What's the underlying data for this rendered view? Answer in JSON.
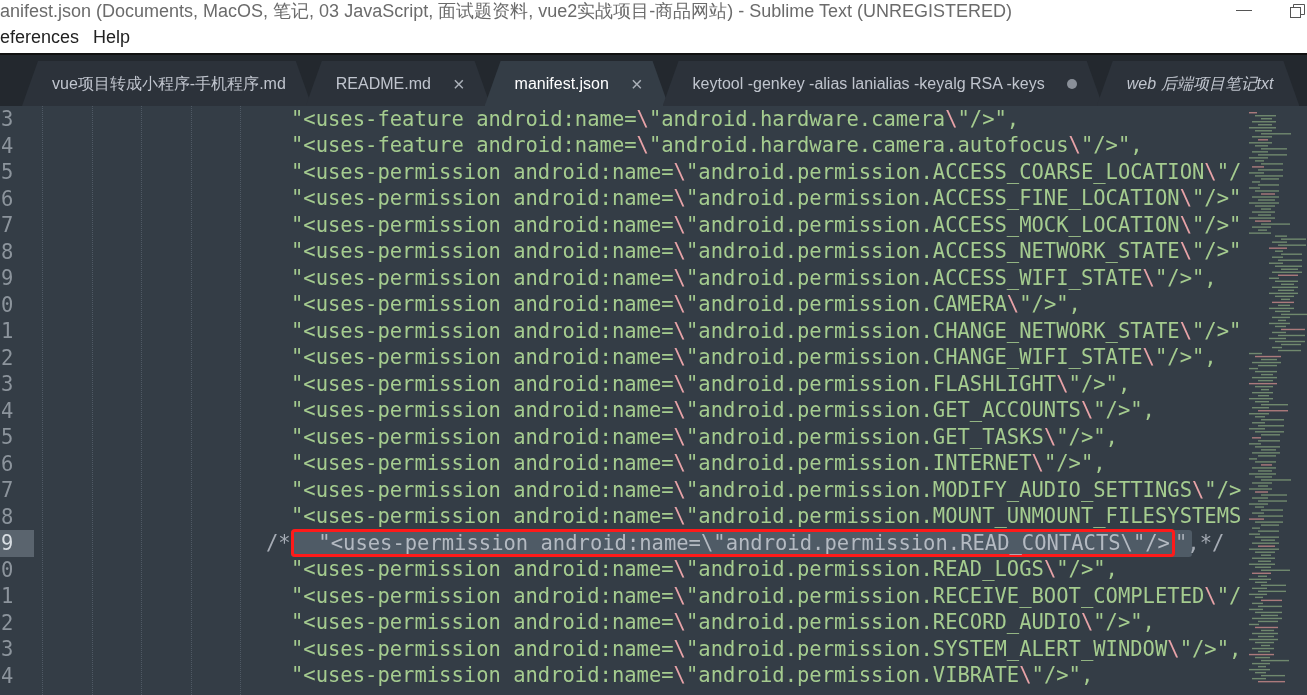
{
  "window": {
    "title": "anifest.json (Documents, MacOS, 笔记, 03 JavaScript, 面试题资料, vue2实战项目-商品网站) - Sublime Text (UNREGISTERED)"
  },
  "menu": [
    "eferences",
    "Help"
  ],
  "tabs": [
    {
      "label": "vue项目转成小程序-手机程序.md",
      "selected": false,
      "modified": false,
      "transient": false
    },
    {
      "label": "README.md",
      "selected": false,
      "modified": false,
      "transient": false,
      "close": "×"
    },
    {
      "label": "manifest.json",
      "selected": true,
      "modified": false,
      "transient": false,
      "close": "×"
    },
    {
      "label": "keytool -genkey -alias lanialias -keyalg RSA -keys",
      "selected": false,
      "modified": true,
      "transient": false
    },
    {
      "label": "web 后端项目笔记txt",
      "selected": false,
      "modified": false,
      "transient": true
    }
  ],
  "lines": [
    {
      "number": "3",
      "kind": "string",
      "selected": false,
      "text": "\"<uses-feature android:name=\\\"android.hardware.camera\\\"/>\","
    },
    {
      "number": "4",
      "kind": "string",
      "selected": false,
      "text": "\"<uses-feature android:name=\\\"android.hardware.camera.autofocus\\\"/>\","
    },
    {
      "number": "5",
      "kind": "string",
      "selected": false,
      "text": "\"<uses-permission android:name=\\\"android.permission.ACCESS_COARSE_LOCATION\\\"/"
    },
    {
      "number": "6",
      "kind": "string",
      "selected": false,
      "text": "\"<uses-permission android:name=\\\"android.permission.ACCESS_FINE_LOCATION\\\"/>\""
    },
    {
      "number": "7",
      "kind": "string",
      "selected": false,
      "text": "\"<uses-permission android:name=\\\"android.permission.ACCESS_MOCK_LOCATION\\\"/>\""
    },
    {
      "number": "8",
      "kind": "string",
      "selected": false,
      "text": "\"<uses-permission android:name=\\\"android.permission.ACCESS_NETWORK_STATE\\\"/>\""
    },
    {
      "number": "9",
      "kind": "string",
      "selected": false,
      "text": "\"<uses-permission android:name=\\\"android.permission.ACCESS_WIFI_STATE\\\"/>\","
    },
    {
      "number": "0",
      "kind": "string",
      "selected": false,
      "text": "\"<uses-permission android:name=\\\"android.permission.CAMERA\\\"/>\","
    },
    {
      "number": "1",
      "kind": "string",
      "selected": false,
      "text": "\"<uses-permission android:name=\\\"android.permission.CHANGE_NETWORK_STATE\\\"/>\""
    },
    {
      "number": "2",
      "kind": "string",
      "selected": false,
      "text": "\"<uses-permission android:name=\\\"android.permission.CHANGE_WIFI_STATE\\\"/>\","
    },
    {
      "number": "3",
      "kind": "string",
      "selected": false,
      "text": "\"<uses-permission android:name=\\\"android.permission.FLASHLIGHT\\\"/>\","
    },
    {
      "number": "4",
      "kind": "string",
      "selected": false,
      "text": "\"<uses-permission android:name=\\\"android.permission.GET_ACCOUNTS\\\"/>\","
    },
    {
      "number": "5",
      "kind": "string",
      "selected": false,
      "text": "\"<uses-permission android:name=\\\"android.permission.GET_TASKS\\\"/>\","
    },
    {
      "number": "6",
      "kind": "string",
      "selected": false,
      "text": "\"<uses-permission android:name=\\\"android.permission.INTERNET\\\"/>\","
    },
    {
      "number": "7",
      "kind": "string",
      "selected": false,
      "text": "\"<uses-permission android:name=\\\"android.permission.MODIFY_AUDIO_SETTINGS\\\"/>"
    },
    {
      "number": "8",
      "kind": "string",
      "selected": false,
      "text": "\"<uses-permission android:name=\\\"android.permission.MOUNT_UNMOUNT_FILESYSTEMS"
    },
    {
      "number": "9",
      "kind": "comment",
      "selected": true,
      "prefix": "/*",
      "text": "\"<uses-permission android:name=\\\"android.permission.READ_CONTACTS\\\"/>",
      "suffix": "\",*/"
    },
    {
      "number": "0",
      "kind": "string",
      "selected": false,
      "text": "\"<uses-permission android:name=\\\"android.permission.READ_LOGS\\\"/>\","
    },
    {
      "number": "1",
      "kind": "string",
      "selected": false,
      "text": "\"<uses-permission android:name=\\\"android.permission.RECEIVE_BOOT_COMPLETED\\\"/"
    },
    {
      "number": "2",
      "kind": "string",
      "selected": false,
      "text": "\"<uses-permission android:name=\\\"android.permission.RECORD_AUDIO\\\"/>\","
    },
    {
      "number": "3",
      "kind": "string",
      "selected": false,
      "text": "\"<uses-permission android:name=\\\"android.permission.SYSTEM_ALERT_WINDOW\\\"/>\","
    },
    {
      "number": "4",
      "kind": "string",
      "selected": false,
      "text": "\"<uses-permission android:name=\\\"android.permission.VIBRATE\\\"/>\","
    }
  ]
}
